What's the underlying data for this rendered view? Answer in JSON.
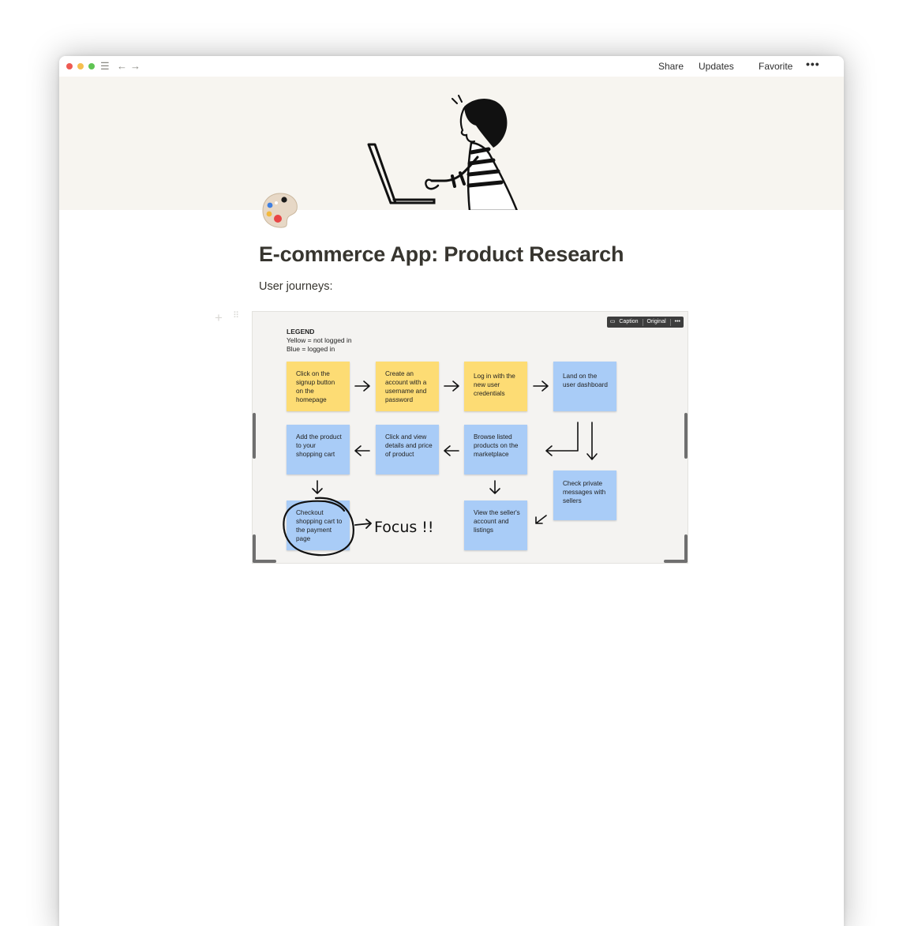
{
  "window": {
    "toolbar": {
      "share_label": "Share",
      "updates_label": "Updates",
      "favorite_label": "Favorite",
      "more_label": "•••"
    }
  },
  "page": {
    "title": "E-commerce App: Product Research",
    "intro": "User journeys:"
  },
  "image_block": {
    "toolbar": {
      "caption_label": "Caption",
      "original_label": "Original",
      "more_label": "•••"
    },
    "legend": {
      "title": "LEGEND",
      "yellow_line": "Yellow = not logged in",
      "blue_line": "Blue = logged in"
    },
    "notes": [
      {
        "text": "Click on the signup button on the homepage",
        "color": "#fddc74"
      },
      {
        "text": "Create an account with a username and password",
        "color": "#fddc74"
      },
      {
        "text": "Log in with the new user credentials",
        "color": "#fddc74"
      },
      {
        "text": "Land on the user dashboard",
        "color": "#a9ccf7"
      },
      {
        "text": "Add the product to your shopping cart",
        "color": "#a9ccf7"
      },
      {
        "text": "Click and view details and price of product",
        "color": "#a9ccf7"
      },
      {
        "text": "Browse listed products on the marketplace",
        "color": "#a9ccf7"
      },
      {
        "text": "Check private messages with sellers",
        "color": "#a9ccf7"
      },
      {
        "text": "Checkout shopping cart to the payment page",
        "color": "#a9ccf7"
      },
      {
        "text": "View the seller's account and listings",
        "color": "#a9ccf7"
      }
    ],
    "annotation": "Focus !!"
  }
}
